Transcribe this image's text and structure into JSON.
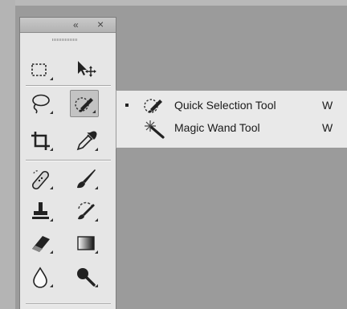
{
  "panel": {
    "collapse_glyph": "«",
    "close_glyph": "×",
    "active_tool": "quick-selection-tool",
    "tools": [
      {
        "name": "rectangular-marquee",
        "icon": "marquee-icon",
        "has_submenu": true
      },
      {
        "name": "move",
        "icon": "move-icon",
        "has_submenu": false
      },
      {
        "name": "lasso",
        "icon": "lasso-icon",
        "has_submenu": true
      },
      {
        "name": "quick-selection",
        "icon": "quick-selection-icon",
        "has_submenu": true
      },
      {
        "name": "crop",
        "icon": "crop-icon",
        "has_submenu": true
      },
      {
        "name": "eyedropper",
        "icon": "eyedropper-icon",
        "has_submenu": true
      },
      {
        "name": "spot-healing-brush",
        "icon": "healing-brush-icon",
        "has_submenu": true
      },
      {
        "name": "brush",
        "icon": "brush-icon",
        "has_submenu": true
      },
      {
        "name": "clone-stamp",
        "icon": "stamp-icon",
        "has_submenu": true
      },
      {
        "name": "history-brush",
        "icon": "history-brush-icon",
        "has_submenu": true
      },
      {
        "name": "eraser",
        "icon": "eraser-icon",
        "has_submenu": true
      },
      {
        "name": "gradient",
        "icon": "gradient-icon",
        "has_submenu": true
      },
      {
        "name": "blur",
        "icon": "blur-drop-icon",
        "has_submenu": true
      },
      {
        "name": "dodge",
        "icon": "dodge-icon",
        "has_submenu": true
      }
    ]
  },
  "flyout": {
    "items": [
      {
        "label": "Quick Selection Tool",
        "shortcut": "W",
        "selected": true,
        "icon": "quick-selection-icon"
      },
      {
        "label": "Magic Wand Tool",
        "shortcut": "W",
        "selected": false,
        "icon": "magic-wand-icon"
      }
    ]
  },
  "colors": {
    "workspace": "#9b9b9b",
    "panel": "#e6e6e6",
    "flyout": "#e9e9e9",
    "active_tool_bg": "#c3c3c3"
  }
}
